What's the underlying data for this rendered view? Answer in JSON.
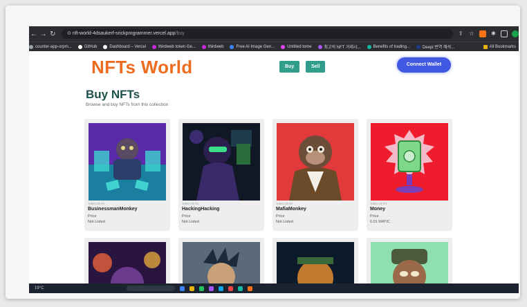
{
  "browser": {
    "url_host": "nft-world-4dsaukerf-srickprogrammer.vercel.app",
    "url_path": "/buy",
    "bookmarks": [
      {
        "label": "counter-app-orpm...",
        "color": "#9aa0a6"
      },
      {
        "label": "GitHub",
        "color": "#ffffff"
      },
      {
        "label": "Dashboard – Vercel",
        "color": "#ffffff"
      },
      {
        "label": "thirdweb token Ge...",
        "color": "#c02bd6"
      },
      {
        "label": "thirdweb",
        "color": "#c02bd6"
      },
      {
        "label": "Free AI Image Gen...",
        "color": "#3b82f6"
      },
      {
        "label": "Untitled tome",
        "color": "#d946ef"
      },
      {
        "label": "최고의 NFT 거래시...",
        "color": "#a855f7"
      },
      {
        "label": "Benefits of trading...",
        "color": "#14b8a6"
      },
      {
        "label": "Deepl 번역 해석...",
        "color": "#1e3a8a"
      }
    ],
    "all_bookmarks": "All Bookmarks"
  },
  "header": {
    "logo": "NFTs World",
    "buy_label": "Buy",
    "sell_label": "Sell",
    "connect_label": "Connect Wallet"
  },
  "main": {
    "title": "Buy NFTs",
    "subtitle": "Browse and buy NFTs from this collection",
    "cards": [
      {
        "token_id": "Token ID #0",
        "name": "BusinessmanMonkey",
        "price_label": "Price",
        "price": "Not Listed"
      },
      {
        "token_id": "Token ID #1",
        "name": "HackingHacking",
        "price_label": "Price",
        "price": "Not Listed"
      },
      {
        "token_id": "Token ID #2",
        "name": "MafiaMonkey",
        "price_label": "Price",
        "price": "Not Listed"
      },
      {
        "token_id": "Token ID #3",
        "name": "Money",
        "price_label": "Price",
        "price": "0.01 MATIC"
      }
    ]
  },
  "taskbar": {
    "weather": "19°C"
  },
  "colors": {
    "accent_orange": "#ee6c20",
    "nav_teal": "#2f9e8a",
    "connect_blue": "#4158e3",
    "title_green": "#1d4f4a"
  }
}
